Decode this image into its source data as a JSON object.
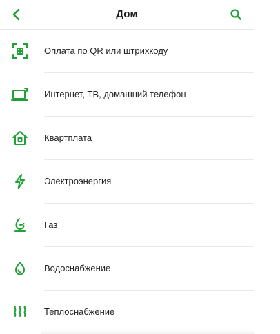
{
  "header": {
    "title": "Дом"
  },
  "colors": {
    "accent": "#21a038"
  },
  "items": [
    {
      "label": "Оплата по QR или штрихкоду",
      "icon": "qr-scan-icon"
    },
    {
      "label": "Интернет, ТВ, домашний телефон",
      "icon": "tv-icon"
    },
    {
      "label": "Квартплата",
      "icon": "house-icon"
    },
    {
      "label": "Электроэнергия",
      "icon": "lightning-icon"
    },
    {
      "label": "Газ",
      "icon": "flame-icon"
    },
    {
      "label": "Водоснабжение",
      "icon": "water-drop-icon"
    },
    {
      "label": "Теплоснабжение",
      "icon": "heat-waves-icon"
    }
  ]
}
